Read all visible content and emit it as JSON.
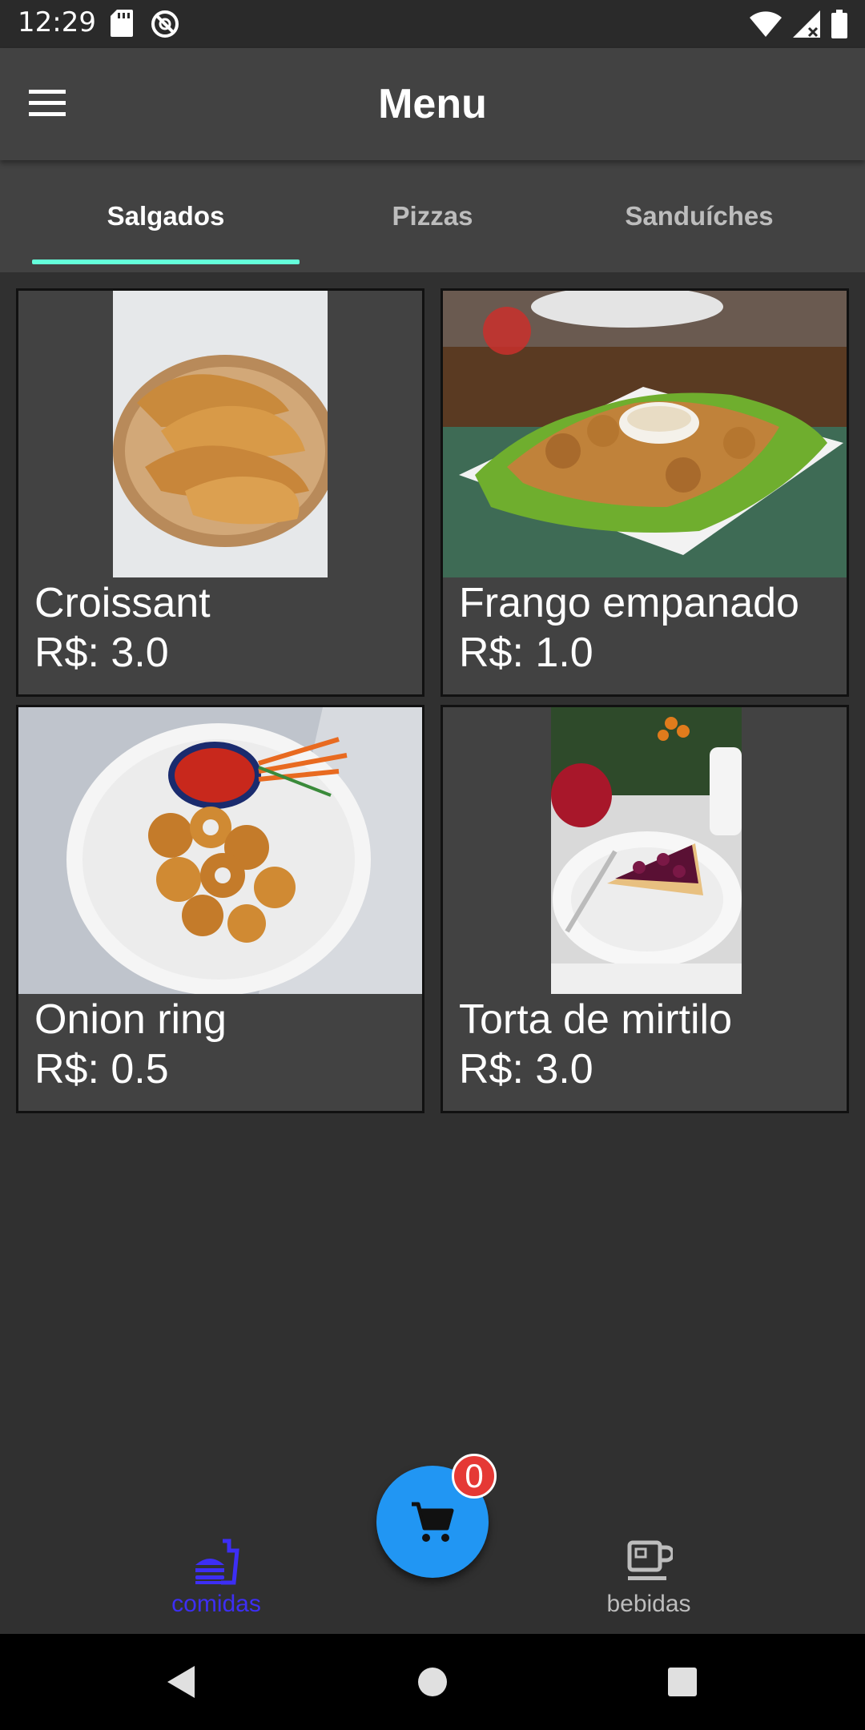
{
  "status_bar": {
    "time": "12:29",
    "left_icons": [
      "sd-card-icon",
      "no-sync-icon"
    ],
    "right_icons": [
      "wifi-icon",
      "signal-icon",
      "battery-icon"
    ]
  },
  "app_bar": {
    "title": "Menu",
    "menu_icon": "hamburger-menu-icon"
  },
  "tabs": [
    {
      "label": "Salgados",
      "active": true
    },
    {
      "label": "Pizzas",
      "active": false
    },
    {
      "label": "Sanduíches",
      "active": false
    }
  ],
  "items": [
    {
      "name": "Croissant",
      "price": "R$: 3.0"
    },
    {
      "name": "Frango empanado",
      "price": "R$: 1.0"
    },
    {
      "name": "Onion ring",
      "price": "R$: 0.5"
    },
    {
      "name": "Torta de mirtilo",
      "price": "R$: 3.0"
    }
  ],
  "cart": {
    "count": "0",
    "icon": "shopping-cart-icon"
  },
  "bottom_nav": [
    {
      "label": "comidas",
      "icon": "fastfood-icon",
      "active": true
    },
    {
      "label": "bebidas",
      "icon": "coffee-icon",
      "active": false
    }
  ],
  "colors": {
    "tab_indicator": "#64ffda",
    "fab": "#2196f3",
    "badge": "#e53935",
    "nav_active": "#3d2ef5",
    "nav_inactive": "#bdbdbd",
    "card_bg": "#424242",
    "app_bar": "#424242",
    "background": "#303030"
  }
}
